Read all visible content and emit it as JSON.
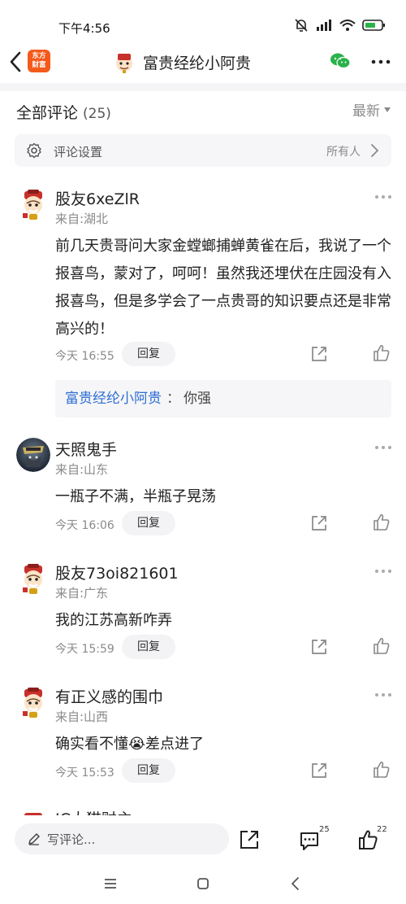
{
  "status_bar": {
    "time": "下午4:56",
    "battery_color": "#2bb24c"
  },
  "nav": {
    "logo_line1": "东方",
    "logo_line2": "财富",
    "title": "富贵经纶小阿贵",
    "brand_color": "#f35a1c",
    "wechat_color": "#2bb24c"
  },
  "header": {
    "title": "全部评论",
    "count": "(25)",
    "sort_label": "最新"
  },
  "settings": {
    "label": "评论设置",
    "value": "所有人"
  },
  "comments": [
    {
      "name": "股友6xeZlR",
      "location": "来自:湖北",
      "text": "前几天贵哥问大家金螳螂捕蝉黄雀在后，我说了一个报喜鸟，蒙对了，呵呵！虽然我还埋伏在庄园没有入报喜鸟，但是多学会了一点贵哥的知识要点还是非常高兴的！",
      "time": "今天 16:55",
      "reply_label": "回复",
      "avatar": "mascot-avatar",
      "sub_reply": {
        "author": "富贵经纶小阿贵",
        "separator": "：",
        "text": "你强"
      }
    },
    {
      "name": "天照鬼手",
      "location": "来自:山东",
      "text": "一瓶子不满，半瓶子晃荡",
      "time": "今天 16:06",
      "reply_label": "回复",
      "avatar": "game-character-avatar"
    },
    {
      "name": "股友73oi821601",
      "location": "来自:广东",
      "text": "我的江苏高新咋弄",
      "time": "今天 15:59",
      "reply_label": "回复",
      "avatar": "mascot-avatar"
    },
    {
      "name": "有正义感的围巾",
      "location": "来自:山西",
      "text_before_emoji": "确实看不懂",
      "emoji": "😭",
      "text_after_emoji": "差点进了",
      "time": "今天 15:53",
      "reply_label": "回复",
      "avatar": "mascot-avatar"
    }
  ],
  "bottom_bar": {
    "compose_placeholder": "写评论...",
    "comment_count": "25",
    "like_count": "22"
  },
  "partial_comment_name": "JC大猫财主"
}
